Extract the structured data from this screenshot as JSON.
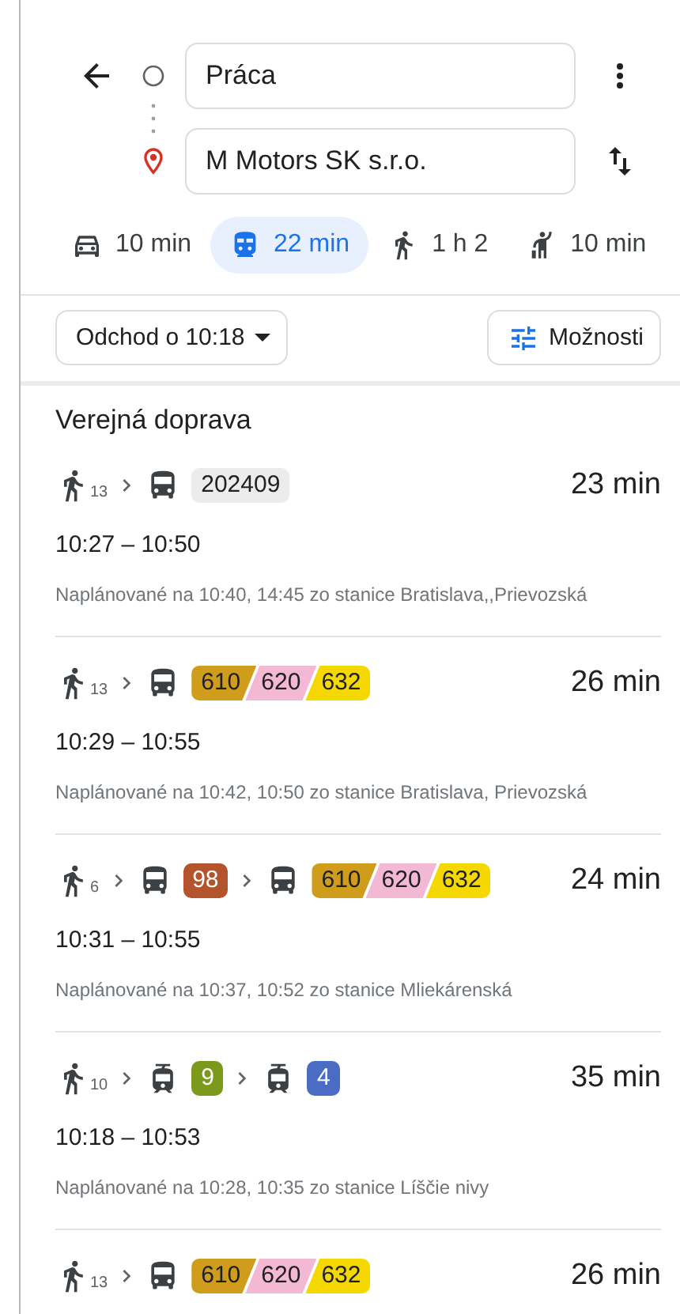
{
  "origin": {
    "value": "Práca"
  },
  "destination": {
    "value": "M Motors SK s.r.o."
  },
  "modes": [
    {
      "kind": "car",
      "label": "10 min",
      "selected": false
    },
    {
      "kind": "transit",
      "label": "22 min",
      "selected": true
    },
    {
      "kind": "walk",
      "label": "1 h 2",
      "selected": false
    },
    {
      "kind": "ride",
      "label": "10 min",
      "selected": false
    }
  ],
  "departure_button": "Odchod o 10:18",
  "options_button": "Možnosti",
  "section_title": "Verejná doprava",
  "routes": [
    {
      "segments": [
        {
          "kind": "walk",
          "minutes": "13"
        },
        {
          "kind": "bus",
          "lines": [
            {
              "label": "202409",
              "color": "#ececec"
            }
          ]
        }
      ],
      "duration": "23 min",
      "times": "10:27 – 10:50",
      "note": "Naplánované na 10:40, 14:45 zo stanice Bratislava,,Prievozská"
    },
    {
      "segments": [
        {
          "kind": "walk",
          "minutes": "13"
        },
        {
          "kind": "bus",
          "lines": [
            {
              "label": "610",
              "color": "#d09c1c"
            },
            {
              "label": "620",
              "color": "#f2b8d4"
            },
            {
              "label": "632",
              "color": "#f5d800"
            }
          ]
        }
      ],
      "duration": "26 min",
      "times": "10:29 – 10:55",
      "note": "Naplánované na 10:42, 10:50 zo stanice Bratislava, Prievozská"
    },
    {
      "segments": [
        {
          "kind": "walk",
          "minutes": "6"
        },
        {
          "kind": "bus",
          "lines": [
            {
              "label": "98",
              "color": "#b4542c"
            }
          ]
        },
        {
          "kind": "bus",
          "lines": [
            {
              "label": "610",
              "color": "#d09c1c"
            },
            {
              "label": "620",
              "color": "#f2b8d4"
            },
            {
              "label": "632",
              "color": "#f5d800"
            }
          ]
        }
      ],
      "duration": "24 min",
      "times": "10:31 – 10:55",
      "note": "Naplánované na 10:37, 10:52 zo stanice Mliekárenská"
    },
    {
      "segments": [
        {
          "kind": "walk",
          "minutes": "10"
        },
        {
          "kind": "tram",
          "lines": [
            {
              "label": "9",
              "color": "#7b9a1c"
            }
          ]
        },
        {
          "kind": "tram",
          "lines": [
            {
              "label": "4",
              "color": "#4a6cc2"
            }
          ]
        }
      ],
      "duration": "35 min",
      "times": "10:18 – 10:53",
      "note": "Naplánované na 10:28, 10:35 zo stanice Líščie nivy"
    },
    {
      "segments": [
        {
          "kind": "walk",
          "minutes": "13"
        },
        {
          "kind": "bus",
          "lines": [
            {
              "label": "610",
              "color": "#d09c1c"
            },
            {
              "label": "620",
              "color": "#f2b8d4"
            },
            {
              "label": "632",
              "color": "#f5d800"
            }
          ]
        }
      ],
      "duration": "26 min"
    }
  ]
}
